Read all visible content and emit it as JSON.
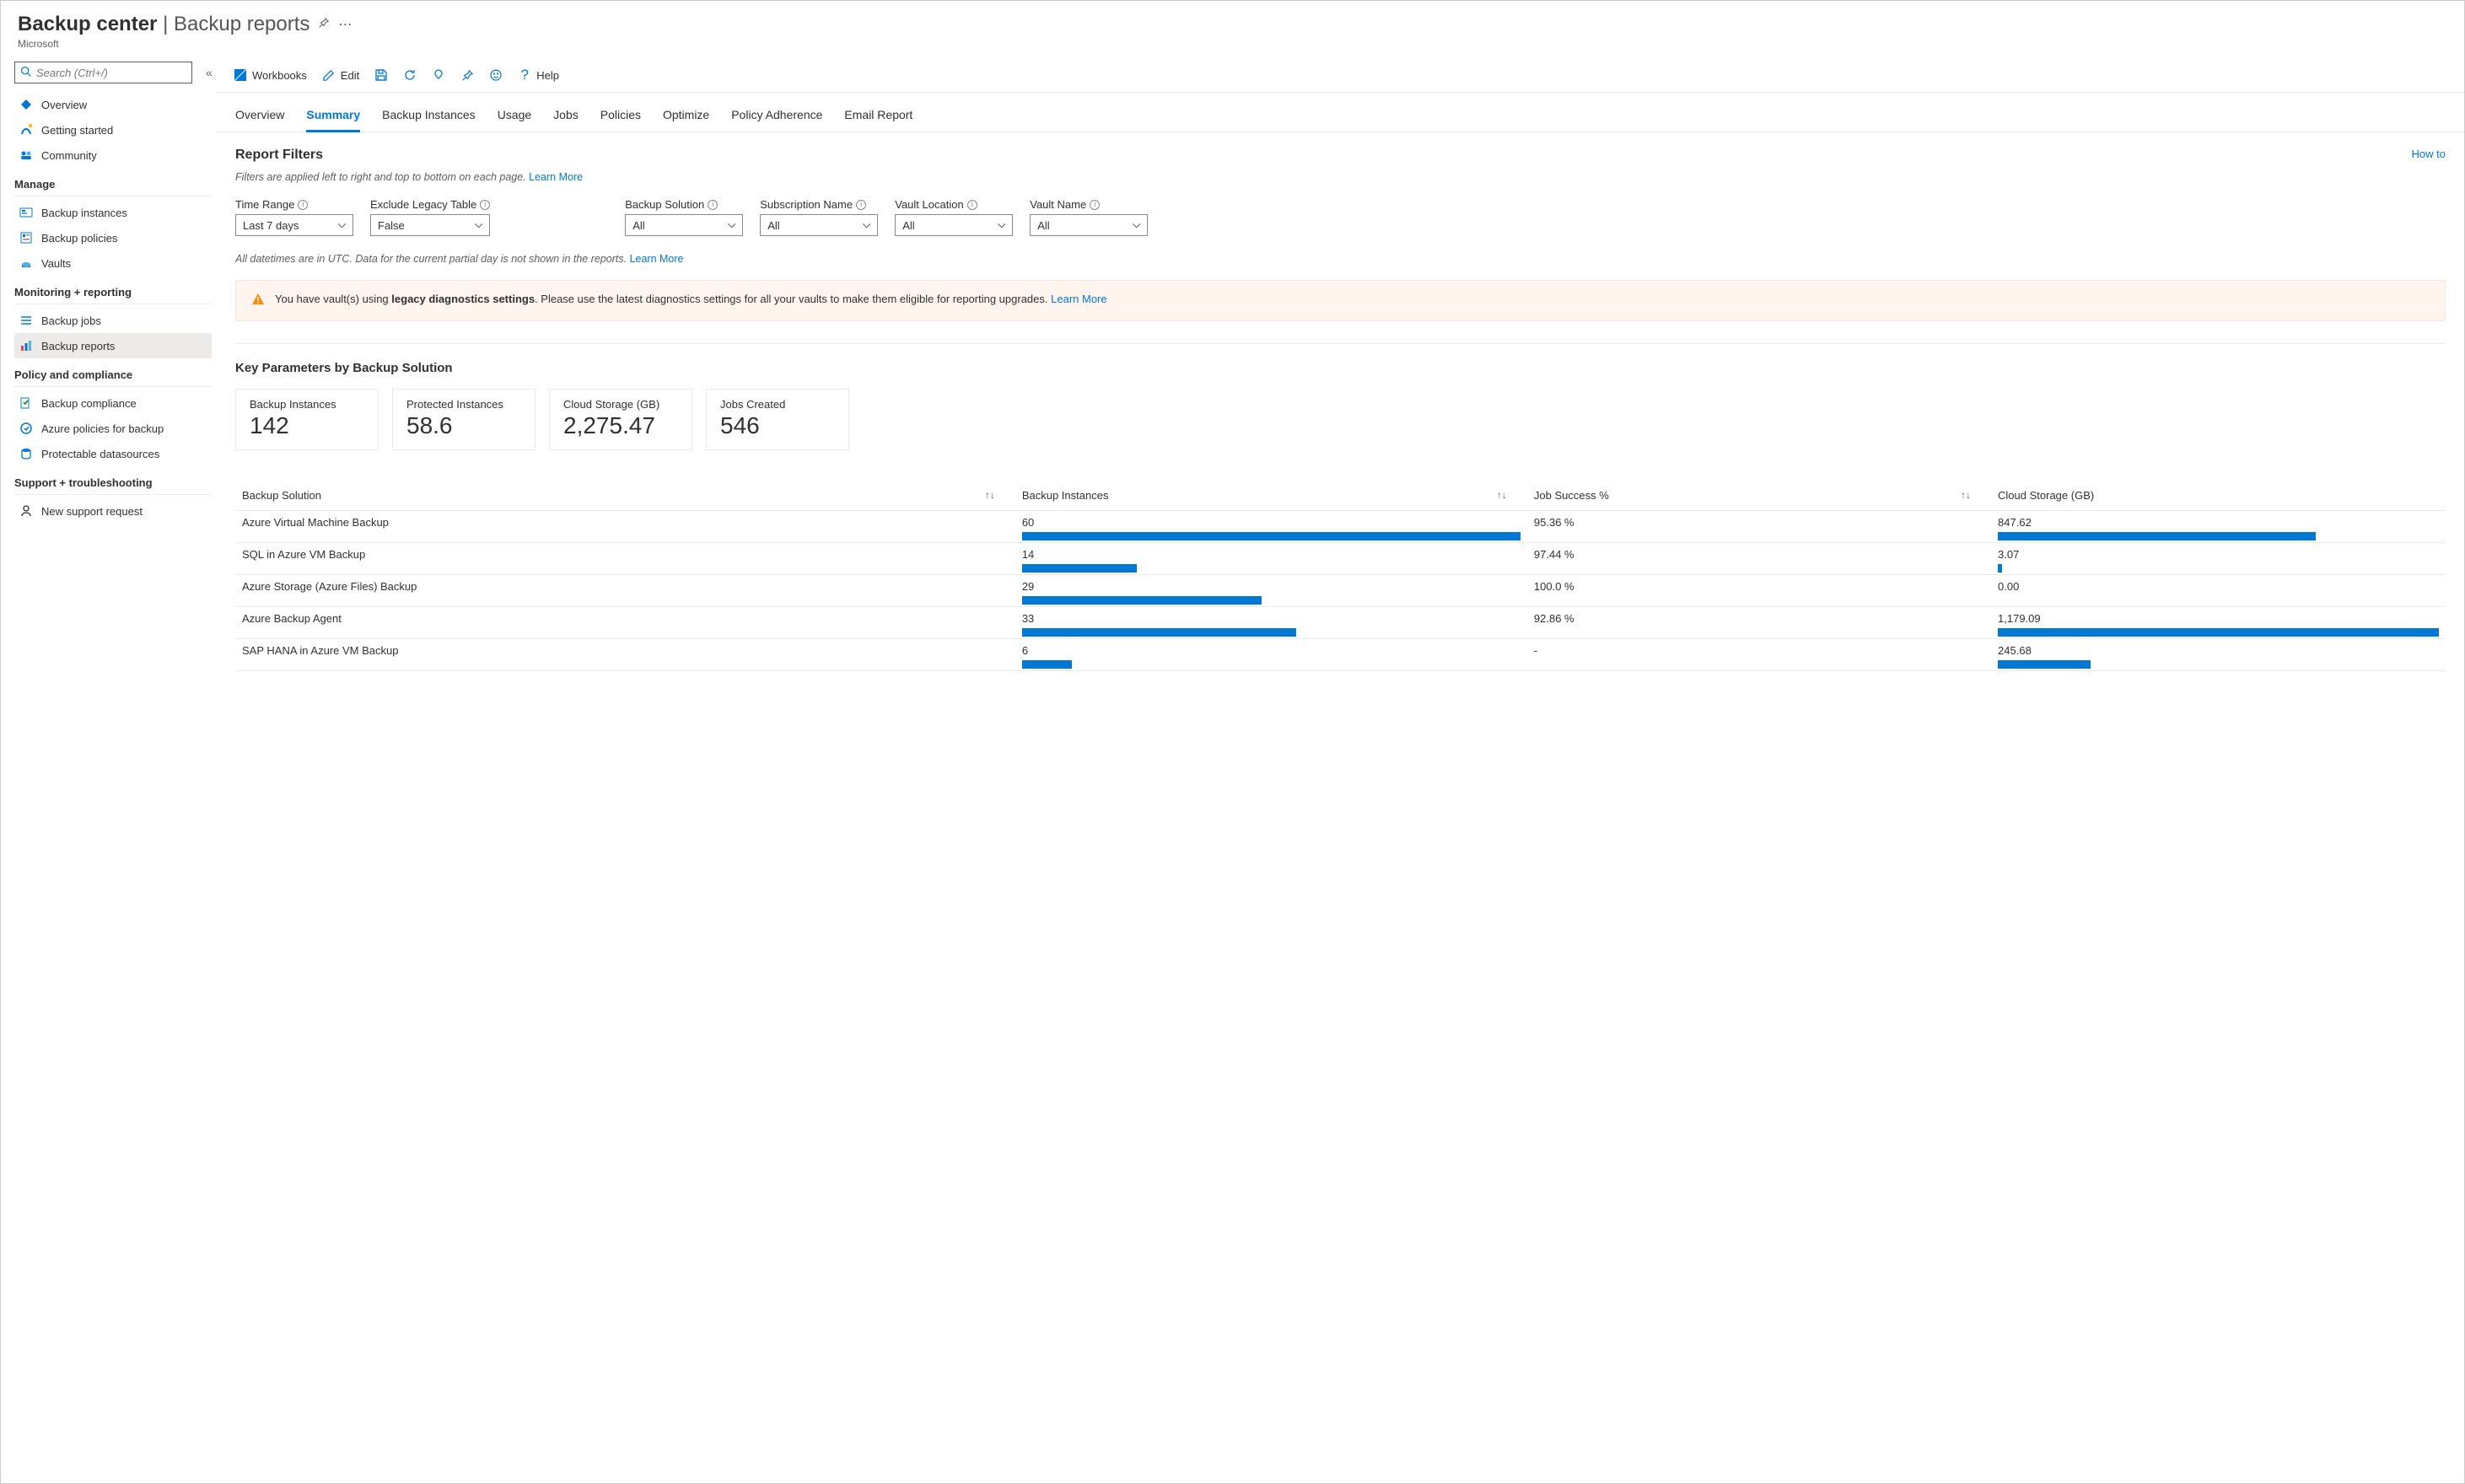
{
  "header": {
    "breadcrumb_a": "Backup center",
    "breadcrumb_b": "Backup reports",
    "subtitle": "Microsoft"
  },
  "sidebar": {
    "search_placeholder": "Search (Ctrl+/)",
    "top_items": [
      {
        "label": "Overview",
        "icon": "overview-icon"
      },
      {
        "label": "Getting started",
        "icon": "getting-started-icon"
      },
      {
        "label": "Community",
        "icon": "community-icon"
      }
    ],
    "groups": [
      {
        "title": "Manage",
        "items": [
          {
            "label": "Backup instances",
            "icon": "backup-instances-icon"
          },
          {
            "label": "Backup policies",
            "icon": "backup-policies-icon"
          },
          {
            "label": "Vaults",
            "icon": "vaults-icon"
          }
        ]
      },
      {
        "title": "Monitoring + reporting",
        "items": [
          {
            "label": "Backup jobs",
            "icon": "backup-jobs-icon"
          },
          {
            "label": "Backup reports",
            "icon": "backup-reports-icon",
            "active": true
          }
        ]
      },
      {
        "title": "Policy and compliance",
        "items": [
          {
            "label": "Backup compliance",
            "icon": "backup-compliance-icon"
          },
          {
            "label": "Azure policies for backup",
            "icon": "azure-policies-icon"
          },
          {
            "label": "Protectable datasources",
            "icon": "protectable-ds-icon"
          }
        ]
      },
      {
        "title": "Support + troubleshooting",
        "items": [
          {
            "label": "New support request",
            "icon": "support-request-icon"
          }
        ]
      }
    ]
  },
  "toolbar": {
    "workbooks": "Workbooks",
    "edit": "Edit",
    "help": "Help"
  },
  "subtabs": [
    "Overview",
    "Summary",
    "Backup Instances",
    "Usage",
    "Jobs",
    "Policies",
    "Optimize",
    "Policy Adherence",
    "Email Report"
  ],
  "active_subtab": "Summary",
  "filters_section": {
    "title": "Report Filters",
    "how_to": "How to",
    "hint_text": "Filters are applied left to right and top to bottom on each page. ",
    "hint_link": "Learn More",
    "filters": [
      {
        "label": "Time Range",
        "value": "Last 7 days",
        "info": true
      },
      {
        "label": "Exclude Legacy Table",
        "value": "False",
        "info": true
      },
      {
        "label": "Backup Solution",
        "value": "All",
        "info": true,
        "gap_before": true
      },
      {
        "label": "Subscription Name",
        "value": "All",
        "info": true
      },
      {
        "label": "Vault Location",
        "value": "All",
        "info": true
      },
      {
        "label": "Vault Name",
        "value": "All",
        "info": true
      }
    ],
    "utc_hint_text": "All datetimes are in UTC. Data for the current partial day is not shown in the reports. ",
    "utc_hint_link": "Learn More"
  },
  "warning": {
    "pre": "You have vault(s) using ",
    "bold": "legacy diagnostics settings",
    "post": ". Please use the latest diagnostics settings for all your vaults to make them eligible for reporting upgrades. ",
    "link": "Learn More"
  },
  "key_params": {
    "title": "Key Parameters by Backup Solution",
    "cards": [
      {
        "label": "Backup Instances",
        "value": "142"
      },
      {
        "label": "Protected Instances",
        "value": "58.6"
      },
      {
        "label": "Cloud Storage (GB)",
        "value": "2,275.47"
      },
      {
        "label": "Jobs Created",
        "value": "546"
      }
    ]
  },
  "table": {
    "headers": [
      "Backup Solution",
      "Backup Instances",
      "Job Success %",
      "Cloud Storage (GB)"
    ],
    "rows": [
      {
        "solution": "Azure Virtual Machine Backup",
        "instances": "60",
        "instances_bar": 100,
        "success": "95.36 %",
        "storage": "847.62",
        "storage_bar": 72
      },
      {
        "solution": "SQL in Azure VM Backup",
        "instances": "14",
        "instances_bar": 23,
        "success": "97.44 %",
        "storage": "3.07",
        "storage_bar": 1
      },
      {
        "solution": "Azure Storage (Azure Files) Backup",
        "instances": "29",
        "instances_bar": 48,
        "success": "100.0 %",
        "storage": "0.00",
        "storage_bar": 0
      },
      {
        "solution": "Azure Backup Agent",
        "instances": "33",
        "instances_bar": 55,
        "success": "92.86 %",
        "storage": "1,179.09",
        "storage_bar": 100
      },
      {
        "solution": "SAP HANA in Azure VM Backup",
        "instances": "6",
        "instances_bar": 10,
        "success": "-",
        "storage": "245.68",
        "storage_bar": 21
      }
    ]
  },
  "chart_data": {
    "type": "table",
    "title": "Key Parameters by Backup Solution",
    "columns": [
      "Backup Solution",
      "Backup Instances",
      "Job Success %",
      "Cloud Storage (GB)"
    ],
    "rows": [
      [
        "Azure Virtual Machine Backup",
        60,
        95.36,
        847.62
      ],
      [
        "SQL in Azure VM Backup",
        14,
        97.44,
        3.07
      ],
      [
        "Azure Storage (Azure Files) Backup",
        29,
        100.0,
        0.0
      ],
      [
        "Azure Backup Agent",
        33,
        92.86,
        1179.09
      ],
      [
        "SAP HANA in Azure VM Backup",
        6,
        null,
        245.68
      ]
    ],
    "summary_cards": {
      "Backup Instances": 142,
      "Protected Instances": 58.6,
      "Cloud Storage (GB)": 2275.47,
      "Jobs Created": 546
    }
  }
}
